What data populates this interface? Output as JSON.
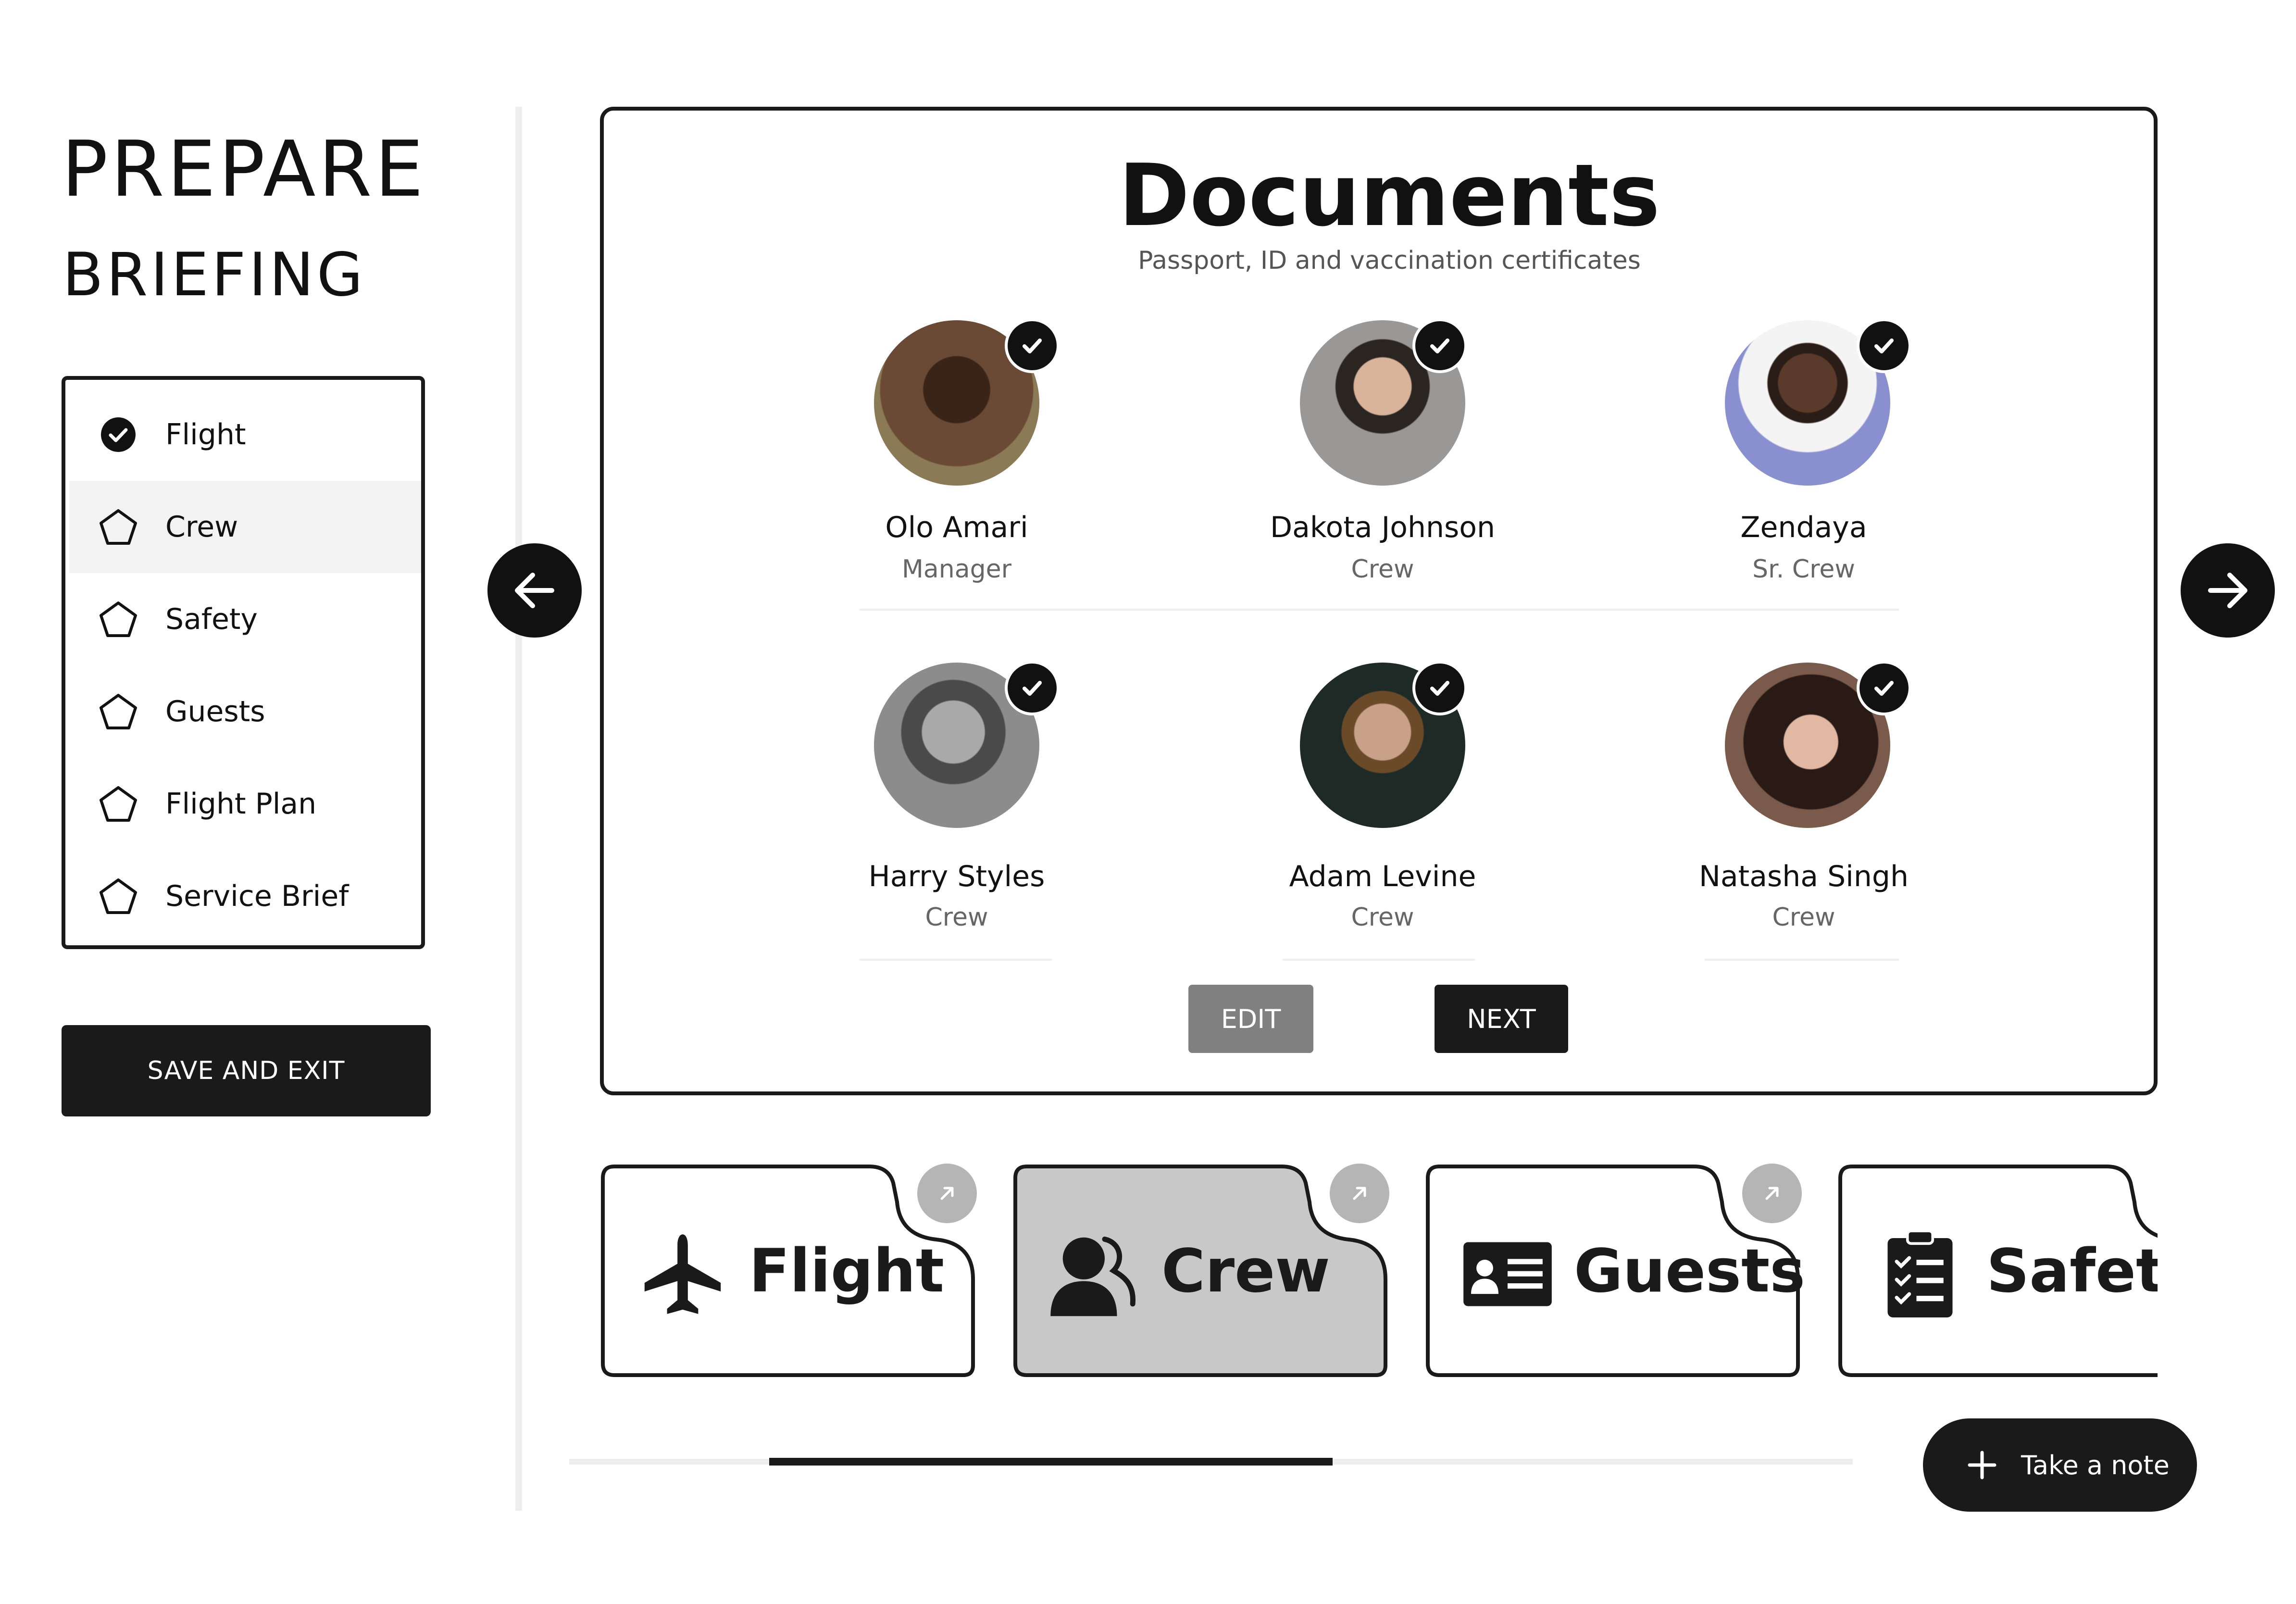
{
  "header": {
    "title_line1": "PREPARE",
    "title_line2": "BRIEFING"
  },
  "steps": [
    {
      "label": "Flight",
      "state": "done",
      "icon": "check-circle-icon"
    },
    {
      "label": "Crew",
      "state": "active",
      "icon": "pentagon-icon"
    },
    {
      "label": "Safety",
      "state": "todo",
      "icon": "pentagon-icon"
    },
    {
      "label": "Guests",
      "state": "todo",
      "icon": "pentagon-icon"
    },
    {
      "label": "Flight Plan",
      "state": "todo",
      "icon": "pentagon-icon"
    },
    {
      "label": "Service Brief",
      "state": "todo",
      "icon": "pentagon-icon"
    }
  ],
  "save_label": "SAVE AND EXIT",
  "documents": {
    "title": "Documents",
    "subtitle": "Passport, ID and vaccination certificates",
    "people": [
      {
        "name": "Olo Amari",
        "role": "Manager",
        "verified": true,
        "avatar_color": "#6b4a35"
      },
      {
        "name": "Dakota Johnson",
        "role": "Crew",
        "verified": true,
        "avatar_color": "#8d8b89"
      },
      {
        "name": "Zendaya",
        "role": "Sr. Crew",
        "verified": true,
        "avatar_color": "#8a8fcf"
      },
      {
        "name": "Harry Styles",
        "role": "Crew",
        "verified": true,
        "avatar_color": "#7a7a7a"
      },
      {
        "name": "Adam Levine",
        "role": "Crew",
        "verified": true,
        "avatar_color": "#2f3a36"
      },
      {
        "name": "Natasha Singh",
        "role": "Crew",
        "verified": true,
        "avatar_color": "#3a2a25"
      }
    ],
    "edit_label": "EDIT",
    "next_label": "NEXT"
  },
  "categories": [
    {
      "label": "Flight",
      "icon": "airplane-icon",
      "selected": false
    },
    {
      "label": "Crew",
      "icon": "user-silhouette-icon",
      "selected": true
    },
    {
      "label": "Guests",
      "icon": "id-card-icon",
      "selected": false
    },
    {
      "label": "Safety",
      "icon": "clipboard-checklist-icon",
      "selected": false
    }
  ],
  "note_label": "Take a note",
  "colors": {
    "dark": "#1a1a1a",
    "selected_tile": "#c8c8c8",
    "muted_button": "#808080"
  }
}
